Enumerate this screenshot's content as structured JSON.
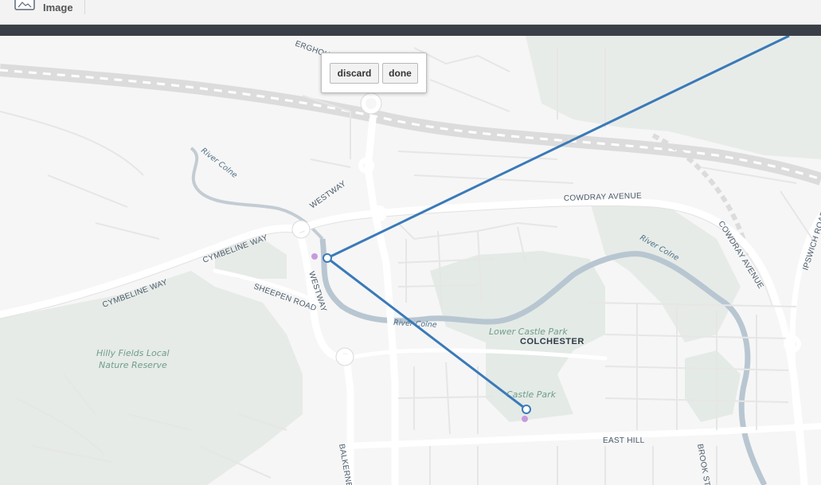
{
  "toolbar": {
    "image_tool_label": "Image",
    "image_tool_icon": "image-icon"
  },
  "popup": {
    "discard_label": "discard",
    "done_label": "done"
  },
  "colors": {
    "route_line": "#3a7ab8",
    "vertex_fill": "#ffffff",
    "poi_dot": "#c79adf",
    "park": "#e6ebe8",
    "water": "#b8c8d4"
  },
  "map": {
    "labels": {
      "westway_north": "WESTWAY",
      "westway_south": "WESTWAY",
      "cymbeline_way_east": "CYMBELINE WAY",
      "cymbeline_way_west": "CYMBELINE WAY",
      "sheepen_road": "SHEEPEN ROAD",
      "cowdray_avenue_north": "COWDRAY AVENUE",
      "cowdray_avenue_east": "COWDRAY AVENUE",
      "ipswich_road": "IPSWICH ROAD",
      "east_hill": "EAST HILL",
      "brook_st": "BROOK ST",
      "balkerne": "BALKERNE",
      "bergholt": "ERGHOLT R",
      "river_colne_1": "River Colne",
      "river_colne_2": "River Colne",
      "river_colne_3": "River Colne",
      "hilly_fields_1": "Hilly Fields Local",
      "hilly_fields_2": "Nature Reserve",
      "lower_castle_park": "Lower Castle Park",
      "colchester": "COLCHESTER",
      "castle_park": "Castle Park"
    }
  }
}
